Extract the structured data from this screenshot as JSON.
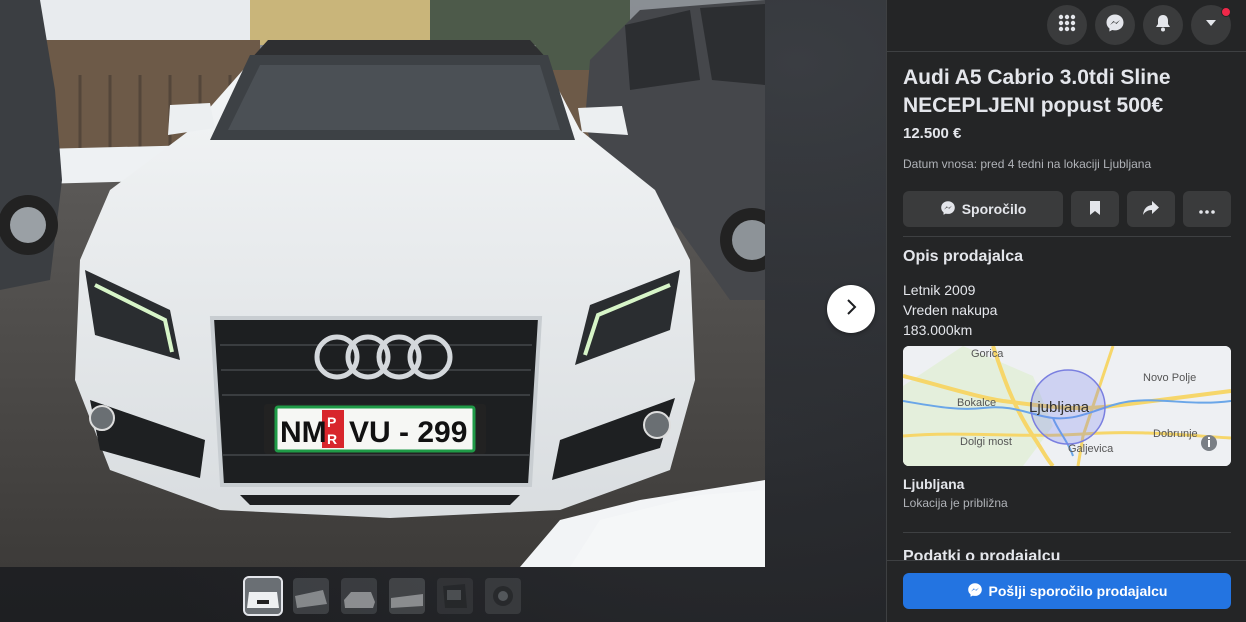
{
  "listing": {
    "title": "Audi A5 Cabrio 3.0tdi Sline NECEPLJENI popust 500€",
    "price": "12.500 €",
    "posted": "Datum vnosa: pred 4 tedni na lokaciji Ljubljana"
  },
  "photo": {
    "plate_left": "NM",
    "plate_badge_top": "P",
    "plate_badge_bottom": "R",
    "plate_right": "VU - 299"
  },
  "actions": {
    "message_label": "Sporočilo"
  },
  "description": {
    "heading": "Opis prodajalca",
    "lines": [
      "Letnik 2009",
      "Vreden nakupa",
      "183.000km"
    ]
  },
  "map": {
    "city": "Ljubljana",
    "places": [
      "Gorica",
      "Novo Polje",
      "Bokalce",
      "Dobrunje",
      "Dolgi most",
      "Galjevica"
    ]
  },
  "location": {
    "name": "Ljubljana",
    "note": "Lokacija je približna"
  },
  "seller": {
    "heading": "Podatki o prodajalcu"
  },
  "cta": {
    "label": "Pošlji sporočilo prodajalcu"
  },
  "colors": {
    "accent": "#2374e1",
    "notification": "#f02849",
    "panel_bg": "#242526"
  },
  "icons": [
    "grid-menu-icon",
    "messenger-icon",
    "bell-icon",
    "caret-down-icon",
    "bookmark-icon",
    "share-icon",
    "more-icon",
    "chevron-right-icon",
    "info-icon"
  ]
}
